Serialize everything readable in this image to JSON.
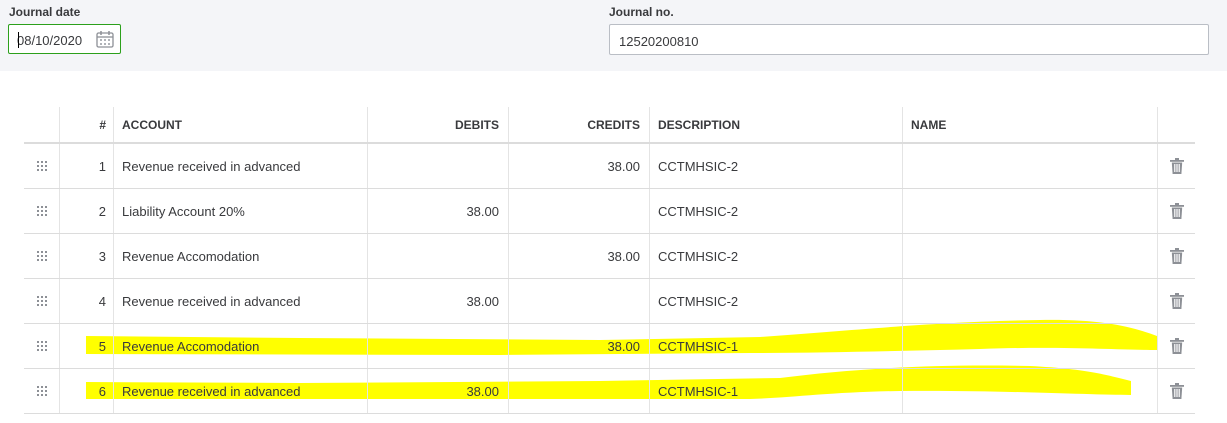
{
  "header": {
    "journal_date_label": "Journal date",
    "journal_date_value": "08/10/2020",
    "journal_no_label": "Journal no.",
    "journal_no_value": "12520200810"
  },
  "table": {
    "columns": {
      "num": "#",
      "account": "ACCOUNT",
      "debits": "DEBITS",
      "credits": "CREDITS",
      "description": "DESCRIPTION",
      "name": "NAME"
    },
    "rows": [
      {
        "num": "1",
        "account": "Revenue received in advanced",
        "debits": "",
        "credits": "38.00",
        "description": "CCTMHSIC-2",
        "name": ""
      },
      {
        "num": "2",
        "account": "Liability Account 20%",
        "debits": "38.00",
        "credits": "",
        "description": "CCTMHSIC-2",
        "name": ""
      },
      {
        "num": "3",
        "account": "Revenue Accomodation",
        "debits": "",
        "credits": "38.00",
        "description": "CCTMHSIC-2",
        "name": ""
      },
      {
        "num": "4",
        "account": "Revenue received in advanced",
        "debits": "38.00",
        "credits": "",
        "description": "CCTMHSIC-2",
        "name": ""
      },
      {
        "num": "5",
        "account": "Revenue Accomodation",
        "debits": "",
        "credits": "38.00",
        "description": "CCTMHSIC-1",
        "name": "",
        "highlighted": true
      },
      {
        "num": "6",
        "account": "Revenue received in advanced",
        "debits": "38.00",
        "credits": "",
        "description": "CCTMHSIC-1",
        "name": "",
        "highlighted": true
      }
    ]
  },
  "icons": {
    "calendar": "calendar-icon",
    "drag": "drag-handle-icon",
    "delete": "trash-icon"
  },
  "colors": {
    "highlight": "#ffff00",
    "focus_border": "#2ca01c",
    "top_background": "#f4f5f8"
  }
}
